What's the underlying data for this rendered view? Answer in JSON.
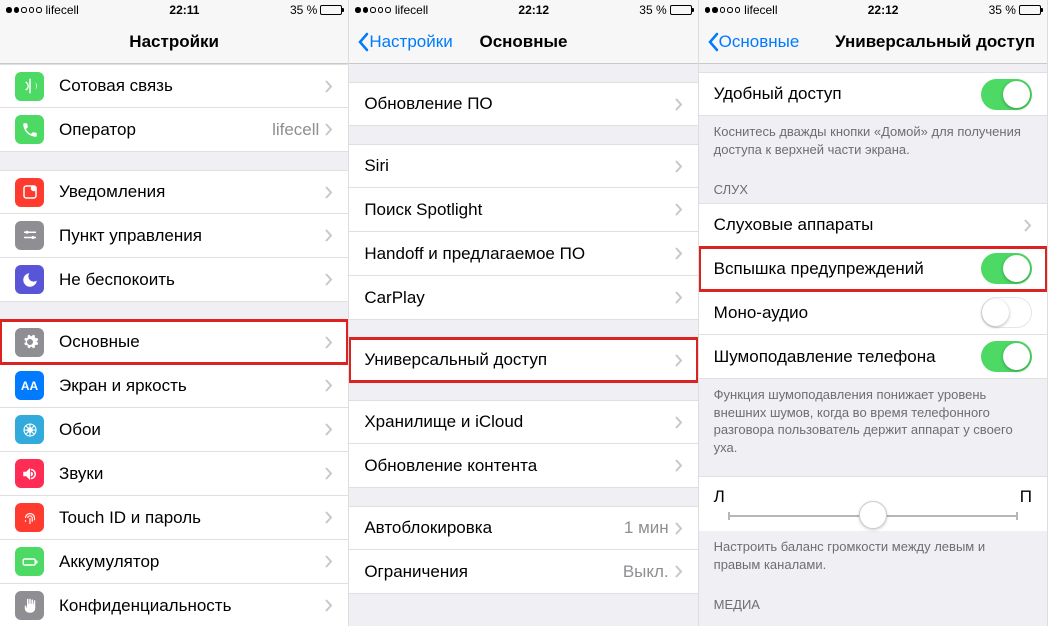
{
  "status": {
    "carrier": "lifecell",
    "battery_text": "35 %"
  },
  "screens": [
    {
      "time": "22:11",
      "title": "Настройки",
      "back": ""
    },
    {
      "time": "22:12",
      "title": "Основные",
      "back": "Настройки"
    },
    {
      "time": "22:12",
      "title": "Универсальный доступ",
      "back": "Основные"
    }
  ],
  "s1": {
    "cellular": "Сотовая связь",
    "operator": "Оператор",
    "operator_val": "lifecell",
    "notifications": "Уведомления",
    "control_center": "Пункт управления",
    "dnd": "Не беспокоить",
    "general": "Основные",
    "display": "Экран и яркость",
    "wallpaper": "Обои",
    "sounds": "Звуки",
    "touchid": "Touch ID и пароль",
    "battery": "Аккумулятор",
    "privacy": "Конфиденциальность"
  },
  "s2": {
    "software_update": "Обновление ПО",
    "siri": "Siri",
    "spotlight": "Поиск Spotlight",
    "handoff": "Handoff и предлагаемое ПО",
    "carplay": "CarPlay",
    "accessibility": "Универсальный доступ",
    "storage": "Хранилище и iCloud",
    "background_refresh": "Обновление контента",
    "autolock": "Автоблокировка",
    "autolock_val": "1 мин",
    "restrictions": "Ограничения",
    "restrictions_val": "Выкл."
  },
  "s3": {
    "reachability": "Удобный доступ",
    "reach_footer": "Коснитесь дважды кнопки «Домой» для получения доступа к верхней части экрана.",
    "hearing_header": "СЛУХ",
    "hearing_aids": "Слуховые аппараты",
    "led_flash": "Вспышка предупреждений",
    "mono_audio": "Моно-аудио",
    "noise_cancel": "Шумоподавление телефона",
    "noise_footer": "Функция шумоподавления понижает уровень внешних шумов, когда во время телефонного разговора пользователь держит аппарат у своего уха.",
    "balance_left": "Л",
    "balance_right": "П",
    "balance_footer": "Настроить баланс громкости между левым и правым каналами.",
    "media_header": "МЕДИА"
  },
  "colors": {
    "green_phone": "#43cc47",
    "red": "#ff3b30",
    "orange": "#ff9500",
    "purple": "#5856d6",
    "gray": "#8e8e93",
    "blue": "#007aff",
    "cyan": "#32aadc",
    "pink": "#ff2d55",
    "green2": "#4cd964"
  }
}
